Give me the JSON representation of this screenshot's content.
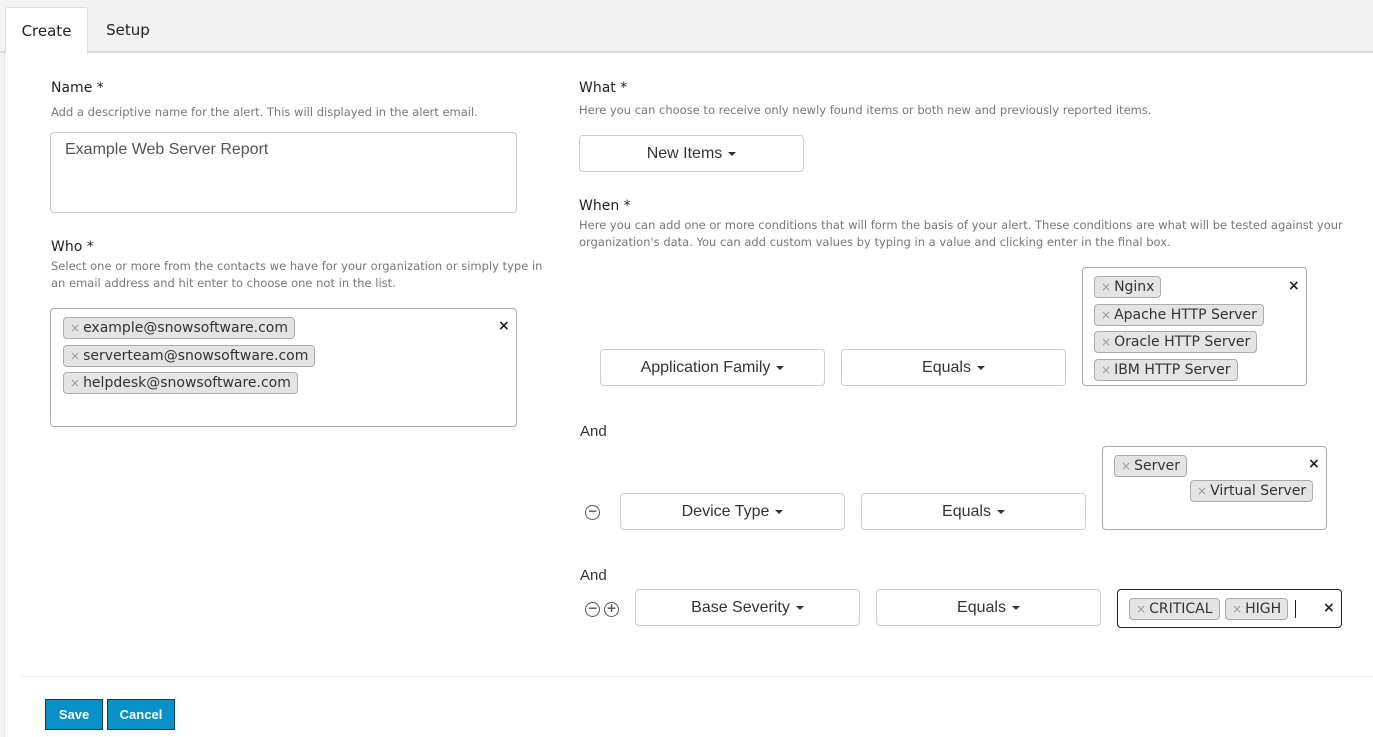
{
  "tabs": [
    {
      "label": "Create",
      "active": true
    },
    {
      "label": "Setup",
      "active": false
    }
  ],
  "name_field": {
    "label": "Name *",
    "help": "Add a descriptive name for the alert. This will displayed in the alert email.",
    "value": "Example Web Server Report"
  },
  "who_field": {
    "label": "Who *",
    "help_line1": "Select one or more from the contacts we have for your organization or simply type in",
    "help_line2": "an email address and hit enter to choose one not in the list.",
    "tags": [
      "example@snowsoftware.com",
      "serverteam@snowsoftware.com",
      "helpdesk@snowsoftware.com"
    ]
  },
  "what_field": {
    "label": "What *",
    "help": "Here you can choose to receive only newly found items or both new and previously reported items.",
    "selected": "New Items"
  },
  "when_field": {
    "label": "When *",
    "help_line1": "Here you can add one or more conditions that will form the basis of your alert. These conditions are what will be tested against your",
    "help_line2": "organization's data. You can add custom values by typing in a value and clicking enter in the final box.",
    "conjunction": "And",
    "conditions": [
      {
        "field": "Application Family",
        "operator": "Equals",
        "values": [
          "Nginx",
          "Apache HTTP Server",
          "Oracle HTTP Server",
          "IBM HTTP Server"
        ]
      },
      {
        "field": "Device Type",
        "operator": "Equals",
        "values": [
          "Server",
          "Virtual Server"
        ]
      },
      {
        "field": "Base Severity",
        "operator": "Equals",
        "values": [
          "CRITICAL",
          "HIGH"
        ]
      }
    ]
  },
  "remove_glyph": "−",
  "add_glyph": "+",
  "tag_remove_glyph": "×",
  "clear_glyph": "×",
  "footer": {
    "save_label": "Save",
    "cancel_label": "Cancel"
  },
  "colors": {
    "primary_button": "#0791c8",
    "primary_border": "#0b3f5c",
    "tab_bar": "#f2f2f2"
  }
}
